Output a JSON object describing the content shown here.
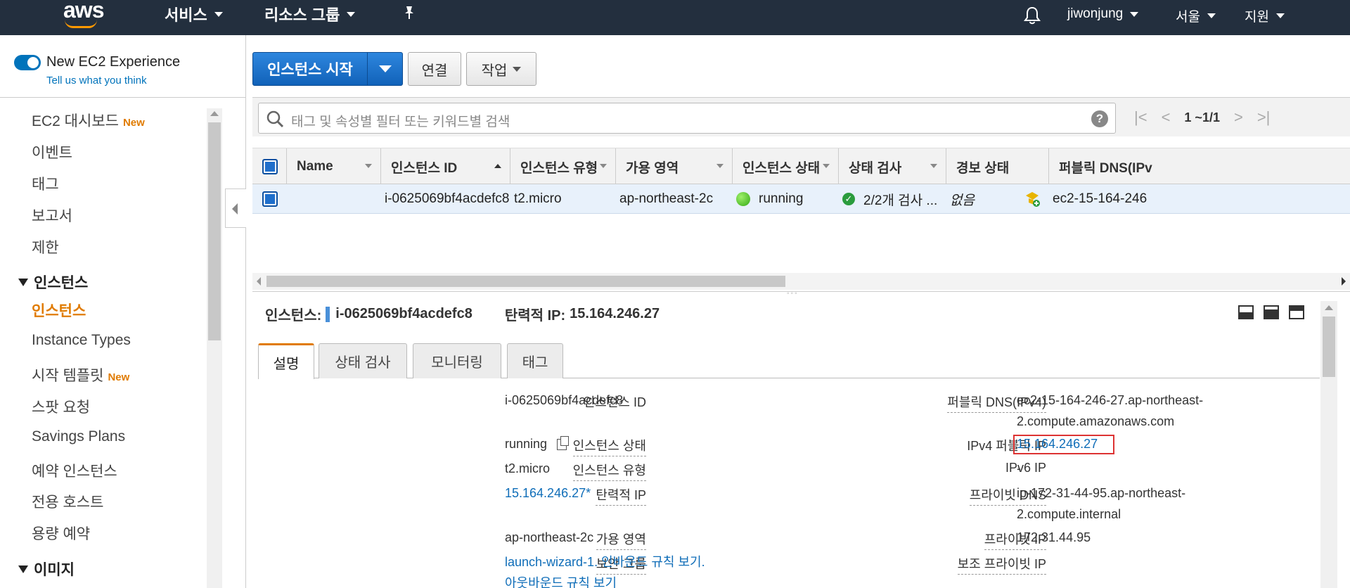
{
  "topnav": {
    "logo": "aws",
    "services": "서비스",
    "resource_groups": "리소스 그룹",
    "user": "jiwonjung",
    "region": "서울",
    "support": "지원"
  },
  "sidebar": {
    "experience_title": "New EC2 Experience",
    "experience_link": "Tell us what you think",
    "items": [
      {
        "label": "EC2 대시보드",
        "badge": "New"
      },
      {
        "label": "이벤트"
      },
      {
        "label": "태그"
      },
      {
        "label": "보고서"
      },
      {
        "label": "제한"
      }
    ],
    "group_instances": "인스턴스",
    "instance_items": [
      {
        "label": "인스턴스"
      },
      {
        "label": "Instance Types"
      },
      {
        "label": "시작 템플릿",
        "badge": "New"
      },
      {
        "label": "스팟 요청"
      },
      {
        "label": "Savings Plans"
      },
      {
        "label": "예약 인스턴스"
      },
      {
        "label": "전용 호스트"
      },
      {
        "label": "용량 예약"
      }
    ],
    "group_images": "이미지"
  },
  "toolbar": {
    "launch": "인스턴스 시작",
    "connect": "연결",
    "actions": "작업"
  },
  "search": {
    "placeholder": "태그 및 속성별 필터 또는 키워드별 검색",
    "help": "?"
  },
  "pager": {
    "count": "1 ~1/1"
  },
  "table": {
    "columns": [
      "Name",
      "인스턴스 ID",
      "인스턴스 유형",
      "가용 영역",
      "인스턴스 상태",
      "상태 검사",
      "경보 상태",
      "퍼블릭 DNS(IPv"
    ],
    "row": {
      "name": "",
      "id": "i-0625069bf4acdefc8",
      "type": "t2.micro",
      "az": "ap-northeast-2c",
      "state": "running",
      "checks": "2/2개 검사 ...",
      "alarm": "없음",
      "dns": "ec2-15-164-246"
    }
  },
  "details": {
    "instance_label": "인스턴스:",
    "instance_id": "i-0625069bf4acdefc8",
    "eip_label": "탄력적 IP:",
    "eip": "15.164.246.27",
    "tabs": [
      "설명",
      "상태 검사",
      "모니터링",
      "태그"
    ],
    "left": [
      {
        "label": "인스턴스 ID",
        "value": "i-0625069bf4acdefc8"
      },
      {
        "label": "인스턴스 상태",
        "value": "running"
      },
      {
        "label": "인스턴스 유형",
        "value": "t2.micro"
      },
      {
        "label": "탄력적 IP",
        "value": "15.164.246.27*"
      },
      {
        "label": "가용 영역",
        "value": "ap-northeast-2c"
      },
      {
        "label": "보안 그룹",
        "value_1": "launch-wizard-1",
        "value_sep": ".",
        "value_2": "인바운드 규칙 보기",
        "value_3": "아웃바운드 규칙 보기"
      }
    ],
    "right": [
      {
        "label": "퍼블릭 DNS(IPv4)",
        "value_1": "ec2-15-164-246-27.ap-northeast-",
        "value_2": "2.compute.amazonaws.com"
      },
      {
        "label": "IPv4 퍼블릭 IP",
        "value": "15.164.246.27"
      },
      {
        "label": "IPv6 IP",
        "value": "-"
      },
      {
        "label": "프라이빗 DNS",
        "value_1": "ip-172-31-44-95.ap-northeast-",
        "value_2": "2.compute.internal"
      },
      {
        "label": "프라이빗 IP",
        "value": "172.31.44.95"
      },
      {
        "label": "보조 프라이빗 IP",
        "value": ""
      }
    ]
  },
  "colors": {
    "nav_bg": "#232f3e",
    "accent_orange": "#e07b00",
    "primary_blue": "#1162b9",
    "link_blue": "#0f6db8",
    "highlight_red": "#dd3333"
  }
}
